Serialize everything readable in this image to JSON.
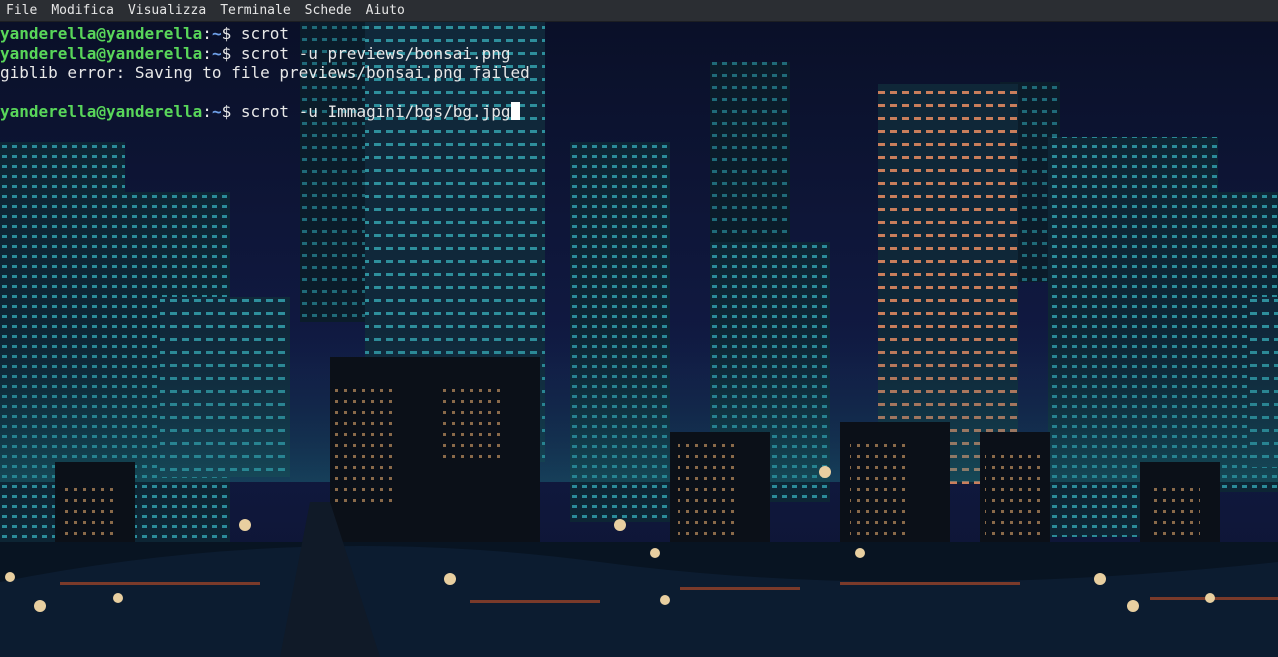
{
  "menubar": {
    "items": [
      "File",
      "Modifica",
      "Visualizza",
      "Terminale",
      "Schede",
      "Aiuto"
    ]
  },
  "terminal": {
    "prompt_user": "yanderella@yanderella",
    "prompt_sep": ":",
    "prompt_path": "~",
    "prompt_symbol": "$ ",
    "lines": [
      {
        "cmd": "scrot"
      },
      {
        "cmd": "scrot -u previews/bonsai.png"
      },
      {
        "output": "giblib error: Saving to file previews/bonsai.png failed"
      },
      {
        "output": ""
      },
      {
        "cmd": "scrot -u Immagini/bgs/bg.jpg",
        "cursor": true
      }
    ]
  },
  "wallpaper": {
    "description_colors": {
      "sky": "#0b1230",
      "building": "#0e2b3b",
      "window_teal": "#2a8d9a",
      "window_orange": "#d0805a",
      "ground": "#081422"
    }
  }
}
